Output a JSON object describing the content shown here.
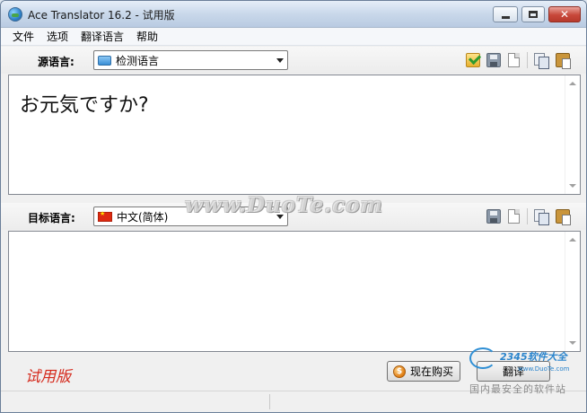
{
  "window": {
    "title": "Ace Translator 16.2 - 试用版",
    "close_glyph": "✕"
  },
  "menu": {
    "items": [
      "文件",
      "选项",
      "翻译语言",
      "帮助"
    ]
  },
  "source": {
    "label": "源语言:",
    "language": "检测语言",
    "text": "お元気ですか?"
  },
  "target": {
    "label": "目标语言:",
    "language": "中文(简体)",
    "text": ""
  },
  "bottom": {
    "trial_label": "试用版",
    "buy_label": "现在购买",
    "coin_glyph": "$",
    "translate_label": "翻译"
  },
  "watermark": {
    "text": "www.DuoTe.com"
  },
  "corner_logo": {
    "brand": "2345软件大全",
    "url": "www.DuoTe.com",
    "subtitle": "国内最安全的软件站"
  },
  "colors": {
    "trial_red": "#d52b1e",
    "close_red": "#c7473a",
    "titlebar_blue": "#c9d8ea"
  }
}
